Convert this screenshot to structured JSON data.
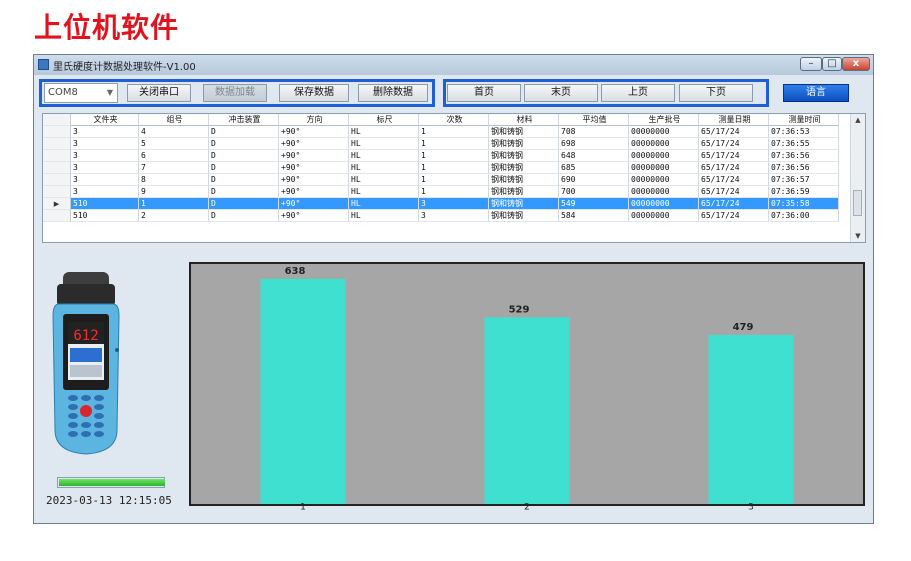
{
  "heading": "上位机软件",
  "window": {
    "title": "里氏硬度计数据处理软件-V1.00",
    "controls": [
      "–",
      "□",
      "x"
    ]
  },
  "toolbar": {
    "port_value": "COM8",
    "close_port": "关闭串口",
    "load_data": "数据加载",
    "save_data": "保存数据",
    "delete_data": "删除数据",
    "first_page": "首页",
    "last_page": "末页",
    "prev_page": "上页",
    "next_page": "下页",
    "language": "语言"
  },
  "table": {
    "columns": [
      "文件夹",
      "组号",
      "冲击装置",
      "方向",
      "标尺",
      "次数",
      "材料",
      "平均值",
      "生产批号",
      "测量日期",
      "测量时间"
    ],
    "rows": [
      [
        "3",
        "4",
        "D",
        "+90°",
        "HL",
        "1",
        "钢和铸钢",
        "708",
        "00000000",
        "65/17/24",
        "07:36:53"
      ],
      [
        "3",
        "5",
        "D",
        "+90°",
        "HL",
        "1",
        "钢和铸钢",
        "698",
        "00000000",
        "65/17/24",
        "07:36:55"
      ],
      [
        "3",
        "6",
        "D",
        "+90°",
        "HL",
        "1",
        "钢和铸钢",
        "648",
        "00000000",
        "65/17/24",
        "07:36:56"
      ],
      [
        "3",
        "7",
        "D",
        "+90°",
        "HL",
        "1",
        "钢和铸钢",
        "685",
        "00000000",
        "65/17/24",
        "07:36:56"
      ],
      [
        "3",
        "8",
        "D",
        "+90°",
        "HL",
        "1",
        "钢和铸钢",
        "690",
        "00000000",
        "65/17/24",
        "07:36:57"
      ],
      [
        "3",
        "9",
        "D",
        "+90°",
        "HL",
        "1",
        "钢和铸钢",
        "700",
        "00000000",
        "65/17/24",
        "07:36:59"
      ],
      [
        "510",
        "1",
        "D",
        "+90°",
        "HL",
        "3",
        "钢和铸钢",
        "549",
        "00000000",
        "65/17/24",
        "07:35:58"
      ],
      [
        "510",
        "2",
        "D",
        "+90°",
        "HL",
        "3",
        "钢和铸钢",
        "584",
        "00000000",
        "65/17/24",
        "07:36:00"
      ]
    ],
    "selected_row": 6
  },
  "device": {
    "display_value": "612"
  },
  "progress_fraction": 1.0,
  "timestamp": "2023-03-13 12:15:05",
  "colors": {
    "accent_border": "#1e5fd6",
    "selection": "#3399ff",
    "chart_bg": "#a6a6a6",
    "bar": "#40e0d0",
    "device_body": "#5cb4e0"
  },
  "chart_data": {
    "type": "bar",
    "categories": [
      "1",
      "2",
      "3"
    ],
    "values": [
      638,
      529,
      479
    ],
    "title": "",
    "xlabel": "",
    "ylabel": "",
    "ylim": [
      0,
      680
    ],
    "grid": false
  }
}
